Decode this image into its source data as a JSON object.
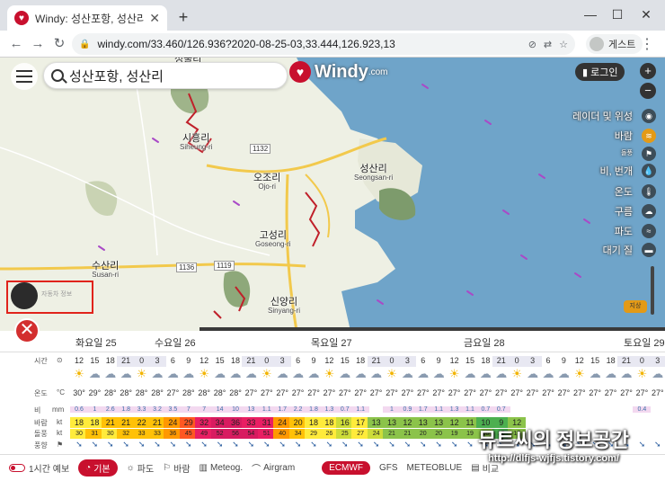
{
  "browser": {
    "tab_title": "Windy: 성산포항, 성산리 일기 예보",
    "url": "windy.com/33.460/126.936?2020-08-25-03,33.444,126.923,13",
    "guest_label": "게스트"
  },
  "map": {
    "search_text": "성산포항, 성산리",
    "logo": "Windy",
    "logo_suffix": ".com",
    "login_label": "로그인",
    "places": [
      {
        "ko": "성불리",
        "en": ""
      },
      {
        "ko": "시흥리",
        "en": "Siheung-ri"
      },
      {
        "ko": "오조리",
        "en": "Ojo-ri"
      },
      {
        "ko": "성산리",
        "en": "Seongsan-ri"
      },
      {
        "ko": "고성리",
        "en": "Goseong-ri"
      },
      {
        "ko": "수산리",
        "en": "Susan-ri"
      },
      {
        "ko": "신양리",
        "en": "Sinyang-ri"
      }
    ],
    "road_signs": [
      "1132",
      "1136",
      "1119"
    ],
    "layers": [
      {
        "label": "레이더 및 위성",
        "icon": "satellite-icon",
        "small": false
      },
      {
        "label": "바람",
        "icon": "wind-icon",
        "small": false
      },
      {
        "label": "돌풍",
        "icon": "flag-icon",
        "small": true
      },
      {
        "label": "비, 번개",
        "icon": "rain-drop-icon",
        "small": false
      },
      {
        "label": "온도",
        "icon": "thermometer-icon",
        "small": false
      },
      {
        "label": "구름",
        "icon": "cloud-icon",
        "small": false
      },
      {
        "label": "파도",
        "icon": "wave-icon",
        "small": false
      },
      {
        "label": "대기 질",
        "icon": "car-icon",
        "small": false
      }
    ],
    "ground_button": "지상",
    "player_label": "자동차 정보"
  },
  "forecast": {
    "days": [
      "화요일 25",
      "수요일 26",
      "목요일 27",
      "금요일 28",
      "토요일 29"
    ],
    "row_labels": {
      "time": "시간",
      "temp": "온도",
      "temp_unit": "°C",
      "rain": "비",
      "rain_unit": "mm",
      "wind": "바람",
      "wind_unit": "kt",
      "gust": "돌풍",
      "gust_unit": "kt",
      "direction": "풍향"
    },
    "hours": [
      "12",
      "15",
      "18",
      "21",
      "0",
      "3",
      "6",
      "9",
      "12",
      "15",
      "18",
      "21",
      "0",
      "3",
      "6",
      "9",
      "12",
      "15",
      "18",
      "21",
      "0",
      "3",
      "6",
      "9",
      "12",
      "15",
      "18",
      "21",
      "0",
      "3",
      "6",
      "9",
      "12",
      "15",
      "18",
      "21",
      "0",
      "3"
    ],
    "temps": [
      "30°",
      "29°",
      "28°",
      "28°",
      "28°",
      "28°",
      "27°",
      "28°",
      "28°",
      "28°",
      "28°",
      "27°",
      "27°",
      "27°",
      "27°",
      "27°",
      "27°",
      "27°",
      "27°",
      "27°",
      "27°",
      "27°",
      "27°",
      "27°",
      "27°",
      "27°",
      "27°",
      "27°",
      "27°",
      "27°",
      "27°",
      "27°",
      "27°",
      "27°",
      "27°",
      "27°",
      "27°",
      "27°"
    ],
    "rain": [
      "0.6",
      "1",
      "2.6",
      "1.8",
      "3.3",
      "3.2",
      "3.5",
      "7",
      "7",
      "14",
      "10",
      "13",
      "1.1",
      "1.7",
      "2.2",
      "1.8",
      "1.3",
      "0.7",
      "1.1",
      "",
      "1",
      "0.9",
      "1.7",
      "1.1",
      "1.3",
      "1.1",
      "0.7",
      "0.7",
      "",
      "",
      "",
      "",
      "",
      "",
      "",
      "",
      "0.4",
      ""
    ],
    "wind": [
      "18",
      "18",
      "21",
      "21",
      "22",
      "21",
      "24",
      "29",
      "32",
      "34",
      "36",
      "33",
      "31",
      "24",
      "20",
      "18",
      "18",
      "16",
      "17",
      "13",
      "13",
      "12",
      "13",
      "13",
      "12",
      "11",
      "10",
      "9",
      "12",
      "",
      "",
      "",
      "",
      "",
      "",
      "",
      "",
      ""
    ],
    "gust": [
      "30",
      "31",
      "30",
      "32",
      "33",
      "33",
      "36",
      "45",
      "49",
      "52",
      "56",
      "54",
      "51",
      "40",
      "34",
      "29",
      "26",
      "25",
      "27",
      "24",
      "21",
      "21",
      "20",
      "20",
      "19",
      "19",
      "18",
      "15",
      "17",
      "",
      "",
      "",
      "",
      "",
      "",
      "",
      "",
      ""
    ]
  },
  "bottom_menu": {
    "hourly": "1시간 예보",
    "basic": "기본",
    "waves": "파도",
    "wind": "바람",
    "meteogram": "Meteog.",
    "airgram": "Airgram",
    "model_ecmwf": "ECMWF",
    "model_gfs": "GFS",
    "model_meteoblue": "METEOBLUE",
    "compare": "비교"
  },
  "watermark": {
    "title": "뮤트씨의 정보공간",
    "url": "http://dlfjs-wjfjs.tistory.com/"
  },
  "colors": {
    "brand": "#c8102e",
    "accent": "#e39a17",
    "sea": "#6fa4c9",
    "land": "#eef0e4"
  }
}
